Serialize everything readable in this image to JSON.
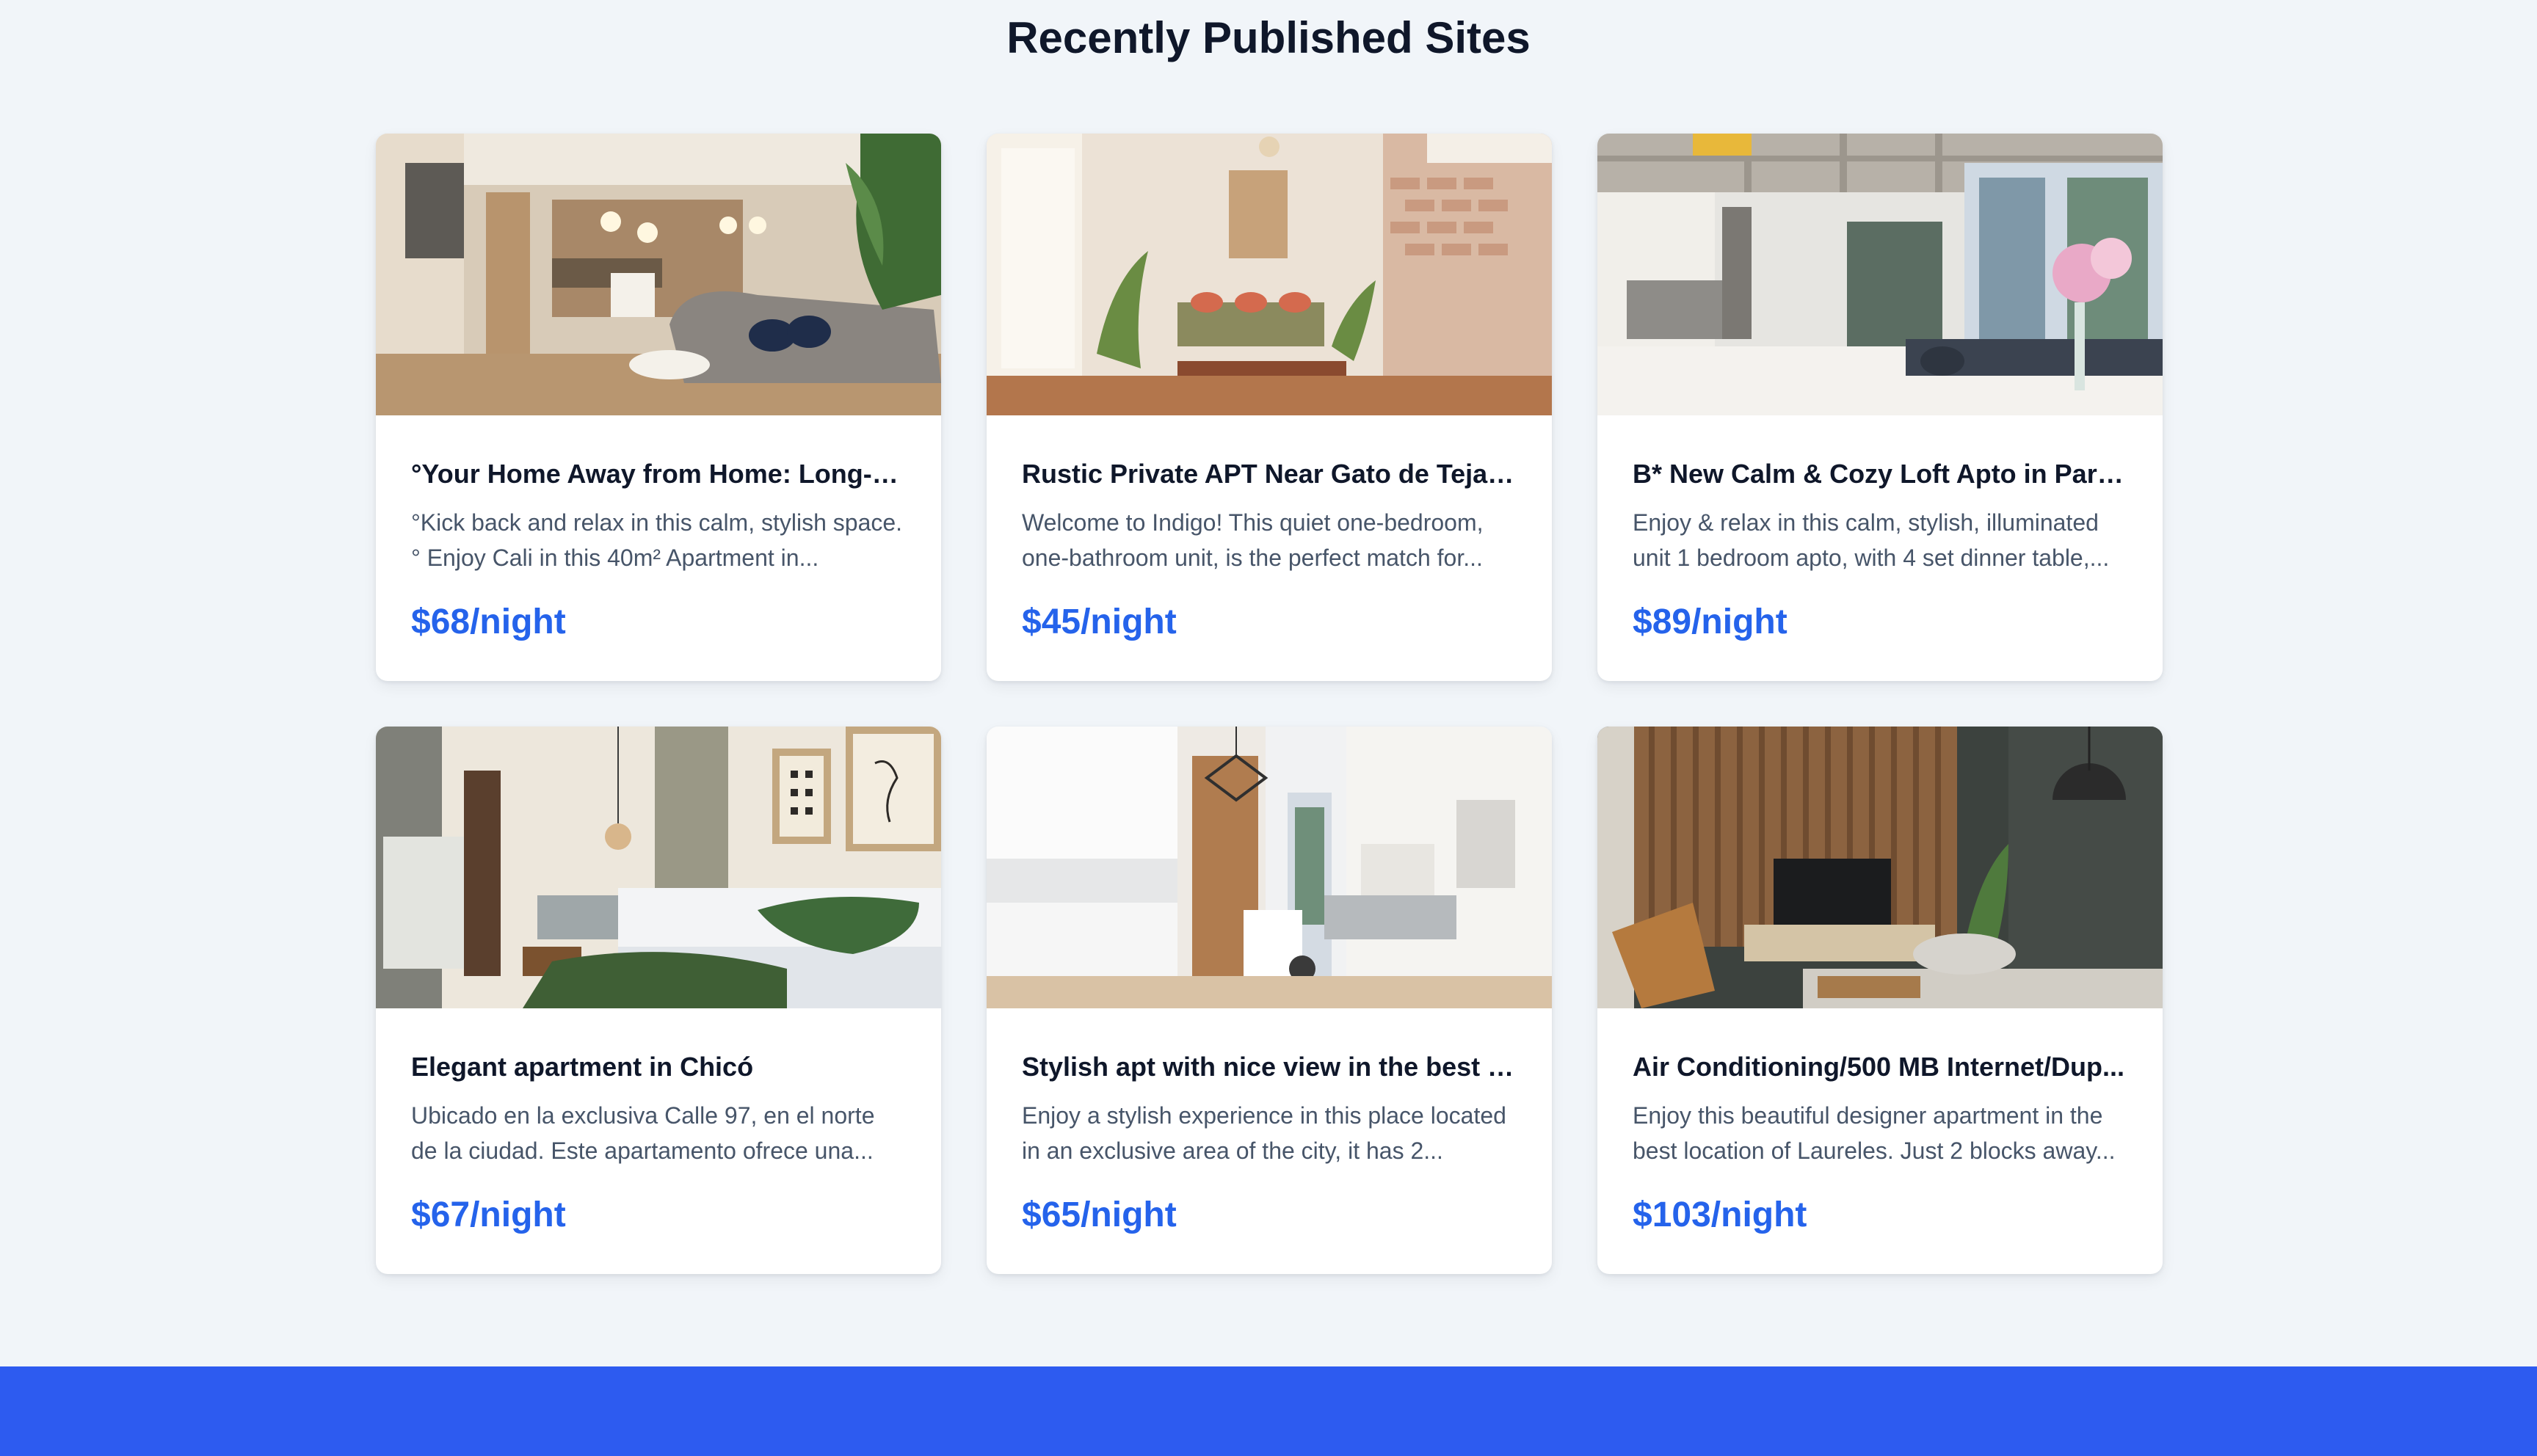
{
  "section": {
    "title": "Recently Published Sites"
  },
  "listings": [
    {
      "title": "°Your Home Away from Home: Long-T...",
      "description": "°Kick back and relax in this calm, stylish space.° Enjoy Cali in this 40m² Apartment in...",
      "price": "$68/night",
      "image": "living-room-kitchen-photo"
    },
    {
      "title": "Rustic Private APT Near Gato de Tejad...",
      "description": "Welcome to Indigo! This quiet one-bedroom, one-bathroom unit, is the perfect match for...",
      "price": "$45/night",
      "image": "rustic-living-room-photo"
    },
    {
      "title": "B* New Calm & Cozy Loft Apto in Park...",
      "description": "Enjoy & relax in this calm, stylish, illuminated unit 1 bedroom apto, with 4 set dinner table,...",
      "price": "$89/night",
      "image": "loft-kitchen-photo"
    },
    {
      "title": "Elegant apartment in Chicó",
      "description": "Ubicado en la exclusiva Calle 97, en el norte de la ciudad. Este apartamento ofrece una...",
      "price": "$67/night",
      "image": "bedroom-photo"
    },
    {
      "title": "Stylish apt with nice view in the best c...",
      "description": "Enjoy a stylish experience in this place located in an exclusive area of the city, it has 2...",
      "price": "$65/night",
      "image": "white-kitchen-view-photo"
    },
    {
      "title": "Air Conditioning/500 MB Internet/Dup...",
      "description": "Enjoy this beautiful designer apartment in the best location of Laureles. Just 2 blocks away...",
      "price": "$103/night",
      "image": "designer-living-room-photo"
    }
  ],
  "colors": {
    "background": "#f1f5f9",
    "price": "#2563eb",
    "footer": "#2d5bf0"
  }
}
